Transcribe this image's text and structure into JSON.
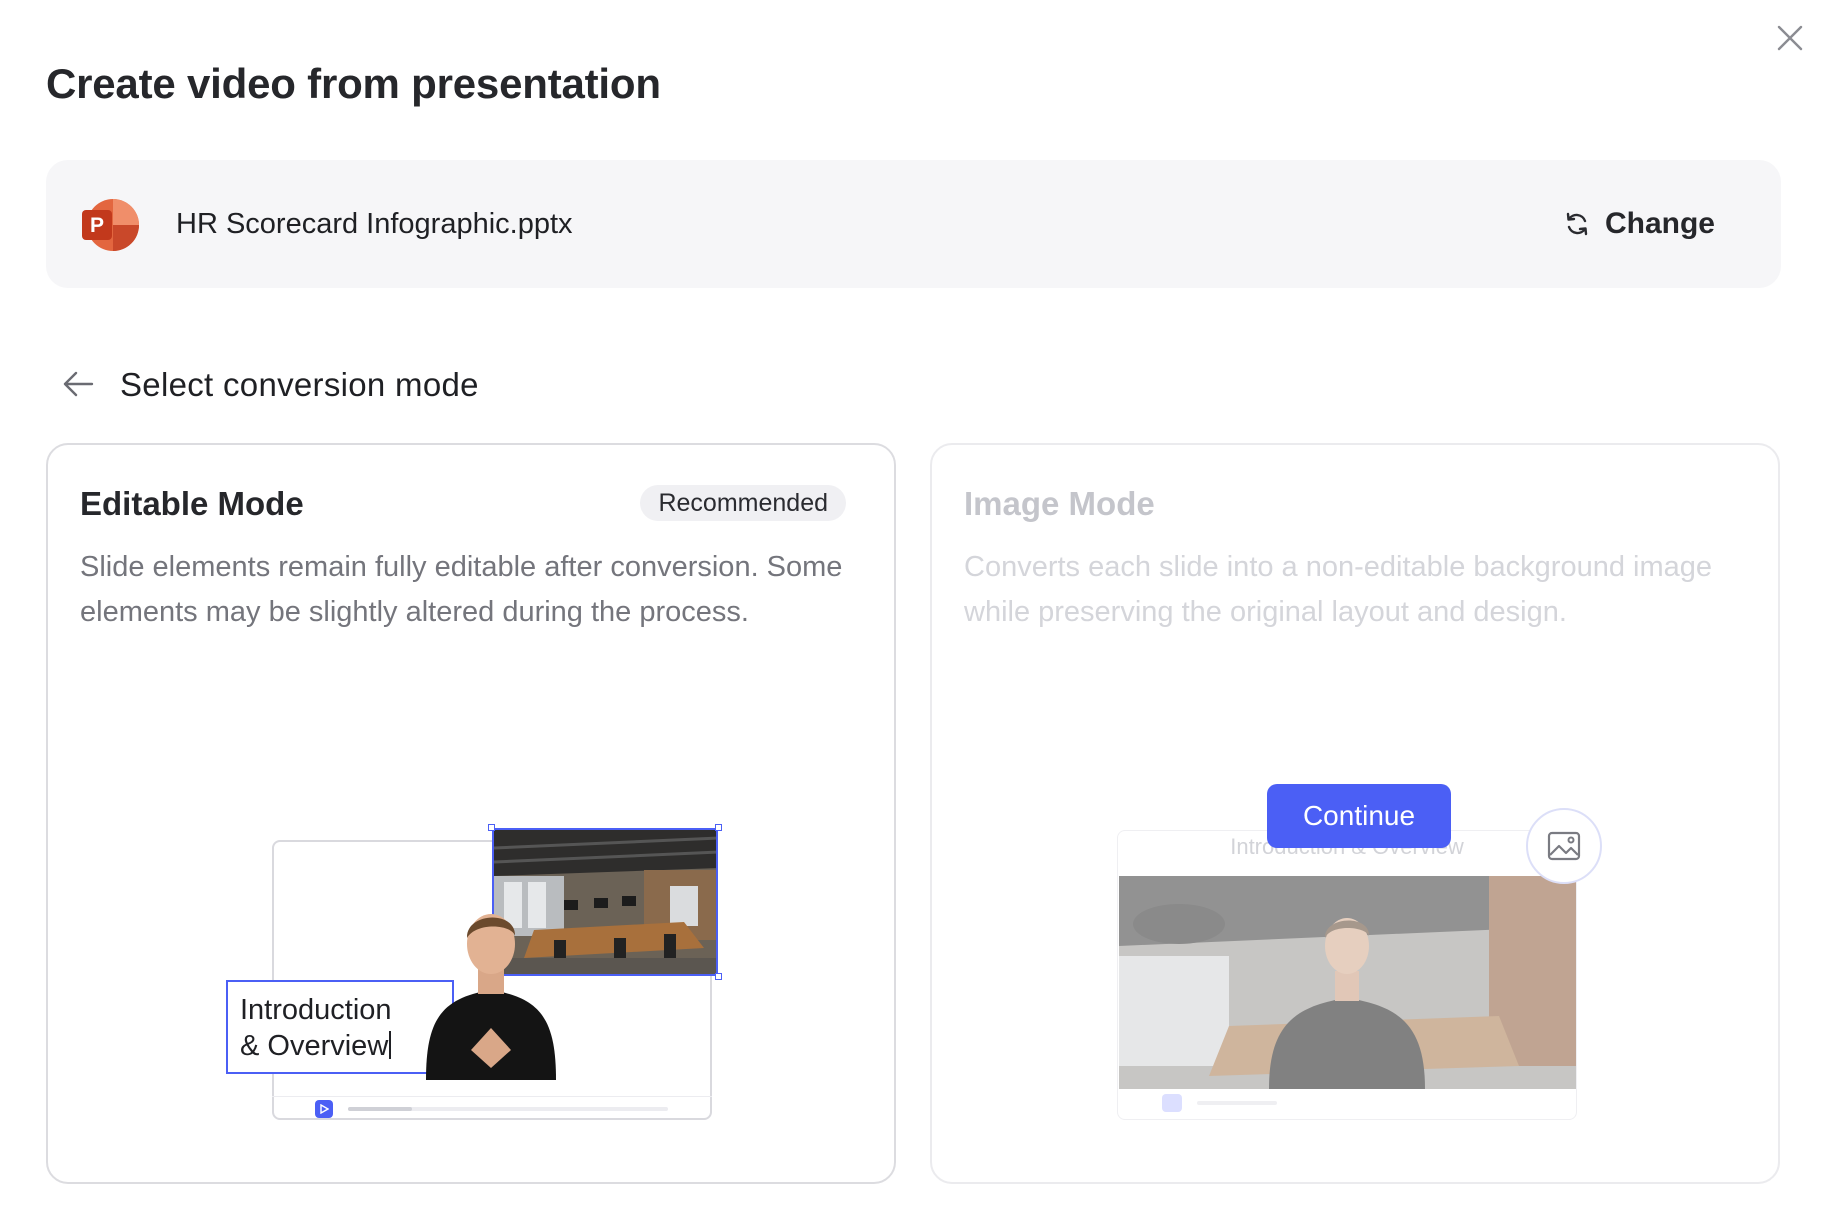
{
  "dialog": {
    "title": "Create video from presentation",
    "close_icon": "close-icon"
  },
  "file": {
    "name": "HR Scorecard Infographic.pptx",
    "icon": "powerpoint-icon",
    "icon_letter": "P",
    "change_label": "Change",
    "change_icon": "refresh-icon"
  },
  "section": {
    "title": "Select conversion mode",
    "back_icon": "arrow-left-icon"
  },
  "modes": {
    "editable": {
      "title": "Editable Mode",
      "badge": "Recommended",
      "description": "Slide elements remain fully editable after conversion. Some elements may be slightly altered during the process.",
      "illustration": {
        "text_line_1": "Introduction",
        "text_line_2": "& Overview",
        "progress": 0.2
      }
    },
    "image": {
      "title": "Image Mode",
      "description": "Converts each slide into a non-editable background image while preserving the original layout and design.",
      "continue_label": "Continue",
      "illustration": {
        "caption": "Introduction & Overview",
        "icon": "image-icon"
      }
    }
  },
  "colors": {
    "accent": "#4b5ff5",
    "ppt_orange": "#d9582f"
  }
}
